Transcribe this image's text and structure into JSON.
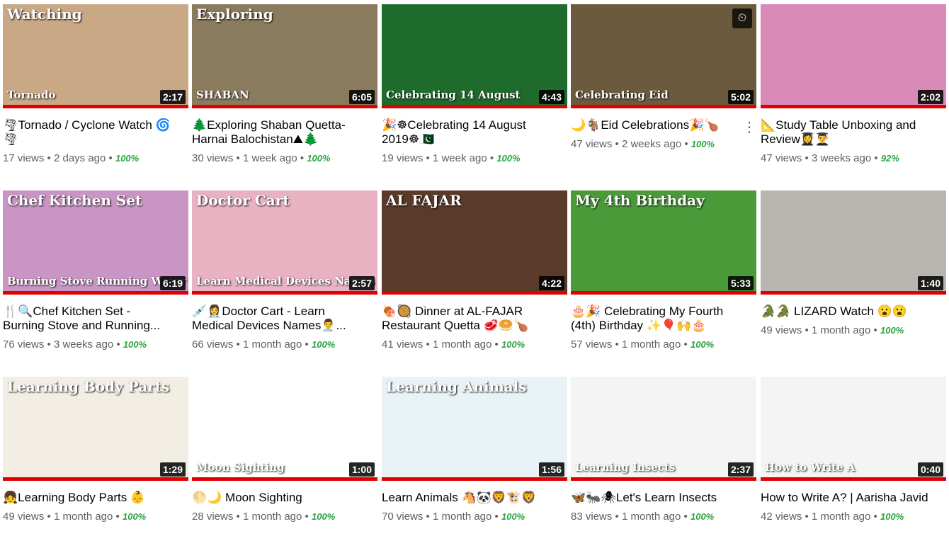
{
  "videos": [
    {
      "title": "🌪Tornado / Cyclone Watch 🌀🌪",
      "views": "17 views",
      "age": "2 days ago",
      "rating": "100%",
      "duration": "2:17",
      "overlay": "Watching",
      "overlay2": "Tornado",
      "bg": "#c9a886"
    },
    {
      "title": "🌲Exploring Shaban Quetta- Harnai Balochistan⛰🌲",
      "views": "30 views",
      "age": "1 week ago",
      "rating": "100%",
      "duration": "6:05",
      "overlay": "Exploring",
      "overlay2": "SHABAN",
      "bg": "#8a7b5e"
    },
    {
      "title": "🎉☸Celebrating 14 August 2019☸🇵🇰",
      "views": "19 views",
      "age": "1 week ago",
      "rating": "100%",
      "duration": "4:43",
      "overlay": "",
      "overlay2": "Celebrating 14 August",
      "bg": "#1f6b2b"
    },
    {
      "title": "🌙🐐Eid Celebrations🎉🍗",
      "views": "47 views",
      "age": "2 weeks ago",
      "rating": "100%",
      "duration": "5:02",
      "overlay": "",
      "overlay2": "Celebrating Eid",
      "bg": "#6b5a3e"
    },
    {
      "title": "📐Study Table Unboxing and Review👩‍🎓👨‍🎓",
      "views": "47 views",
      "age": "3 weeks ago",
      "rating": "92%",
      "duration": "2:02",
      "overlay": "",
      "overlay2": "",
      "bg": "#d98bb8"
    },
    {
      "title": "🍴🔍Chef Kitchen Set - Burning Stove and Running...",
      "views": "76 views",
      "age": "3 weeks ago",
      "rating": "100%",
      "duration": "6:19",
      "overlay": "Chef Kitchen Set",
      "overlay2": "Burning Stove Running Water",
      "bg": "#c995c5"
    },
    {
      "title": "💉👩‍⚕️Doctor Cart - Learn Medical Devices Names👨‍⚕️...",
      "views": "66 views",
      "age": "1 month ago",
      "rating": "100%",
      "duration": "2:57",
      "overlay": "Doctor Cart",
      "overlay2": "Learn Medical Devices Names",
      "bg": "#e9b2c3"
    },
    {
      "title": "🍖🥘 Dinner at AL-FAJAR Restaurant Quetta 🥩🥯🍗",
      "views": "41 views",
      "age": "1 month ago",
      "rating": "100%",
      "duration": "4:22",
      "overlay": "AL FAJAR",
      "overlay2": "",
      "bg": "#5a3b2a"
    },
    {
      "title": "🎂🎉 Celebrating My Fourth (4th) Birthday ✨🎈🙌🎂",
      "views": "57 views",
      "age": "1 month ago",
      "rating": "100%",
      "duration": "5:33",
      "overlay": "My 4th Birthday",
      "overlay2": "",
      "bg": "#4a9a3a"
    },
    {
      "title": "🐊🐊 LIZARD Watch 😮😮",
      "views": "49 views",
      "age": "1 month ago",
      "rating": "100%",
      "duration": "1:40",
      "overlay": "",
      "overlay2": "",
      "bg": "#b8b6b0"
    },
    {
      "title": "👧Learning Body Parts 👶",
      "views": "49 views",
      "age": "1 month ago",
      "rating": "100%",
      "duration": "1:29",
      "overlay": "Learning Body Parts",
      "overlay2": "",
      "bg": "#f2eee4"
    },
    {
      "title": "🌕🌙 Moon Sighting",
      "views": "28 views",
      "age": "1 month ago",
      "rating": "100%",
      "duration": "1:00",
      "overlay": "",
      "overlay2": "Moon Sighting",
      "bg": "#ffffff"
    },
    {
      "title": "Learn Animals 🐴🐼🦁🐮🦁",
      "views": "70 views",
      "age": "1 month ago",
      "rating": "100%",
      "duration": "1:56",
      "overlay": "Learning Animals",
      "overlay2": "",
      "bg": "#e9f3f7"
    },
    {
      "title": "🦋🐜🕷Let's Learn Insects",
      "views": "83 views",
      "age": "1 month ago",
      "rating": "100%",
      "duration": "2:37",
      "overlay": "",
      "overlay2": "Learning Insects",
      "bg": "#f4f4f4"
    },
    {
      "title": "How to Write A? | Aarisha Javid",
      "views": "42 views",
      "age": "1 month ago",
      "rating": "100%",
      "duration": "0:40",
      "overlay": "",
      "overlay2": "How to Write A",
      "bg": "#f4f4f4"
    }
  ],
  "separator": "•",
  "colors": {
    "progress": "#e00000",
    "rating": "#2ba640"
  }
}
